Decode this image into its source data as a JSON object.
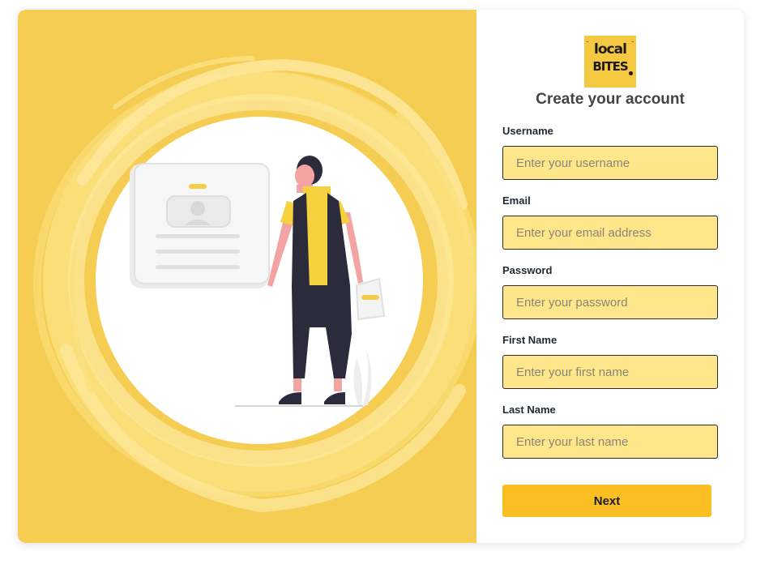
{
  "brand": {
    "logo_line1": "local",
    "logo_line2": "BITES",
    "logo_tm": "™",
    "colors": {
      "panel": "#f4cd52",
      "logo": "#f5c842",
      "input_bg": "#fee68b",
      "button": "#fbbf24"
    }
  },
  "form": {
    "title": "Create your account",
    "fields": [
      {
        "label": "Username",
        "placeholder": "Enter your username",
        "type": "text"
      },
      {
        "label": "Email",
        "placeholder": "Enter your email address",
        "type": "email"
      },
      {
        "label": "Password",
        "placeholder": "Enter your password",
        "type": "password"
      },
      {
        "label": "First Name",
        "placeholder": "Enter your first name",
        "type": "text"
      },
      {
        "label": "Last Name",
        "placeholder": "Enter your last name",
        "type": "text"
      }
    ],
    "next_label": "Next"
  },
  "illustration": {
    "icons": [
      "id-card-icon",
      "person-illustration",
      "shopping-bag-icon",
      "plant-icon"
    ]
  }
}
